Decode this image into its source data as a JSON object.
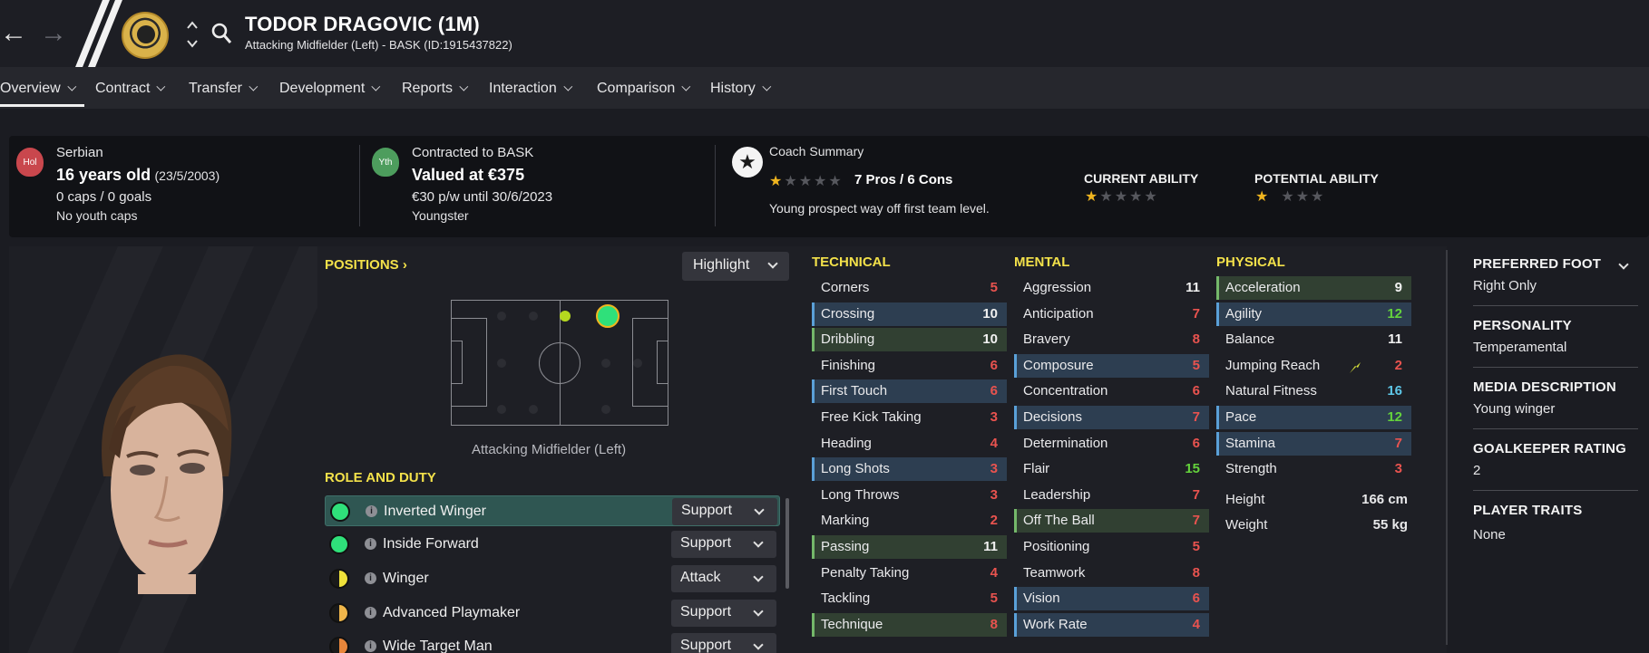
{
  "header": {
    "back_icon": "back-arrow-icon",
    "forward_icon": "forward-arrow-icon",
    "player_name": "TODOR DRAGOVIC (1M)",
    "subtitle": "Attacking Midfielder (Left) - BASK (ID:1915437822)"
  },
  "tabs": [
    {
      "label": "Overview"
    },
    {
      "label": "Contract"
    },
    {
      "label": "Transfer"
    },
    {
      "label": "Development"
    },
    {
      "label": "Reports"
    },
    {
      "label": "Interaction"
    },
    {
      "label": "Comparison"
    },
    {
      "label": "History"
    }
  ],
  "summary": {
    "nat_badge": "Hol",
    "nationality": "Serbian",
    "age": "16 years old",
    "dob": "(23/5/2003)",
    "caps": "0 caps / 0 goals",
    "youth_caps": "No youth caps",
    "contract_badge": "Yth",
    "contracted": "Contracted to BASK",
    "value": "Valued at €375",
    "wage": "€30 p/w until 30/6/2023",
    "status": "Youngster",
    "coach_title": "Coach Summary",
    "pros_cons": "7 Pros / 6 Cons",
    "coach_text": "Young prospect way off first team level.",
    "current_ability_label": "CURRENT ABILITY",
    "potential_ability_label": "POTENTIAL ABILITY",
    "coach_stars": 1,
    "current_ability_stars": 1,
    "potential_ability_stars": 1
  },
  "positions": {
    "title": "POSITIONS",
    "highlight": "Highlight",
    "position_label": "Attacking Midfielder (Left)"
  },
  "roles": {
    "title": "ROLE AND DUTY",
    "items": [
      {
        "name": "Inverted Winger",
        "duty": "Support",
        "color": "#2fe07a",
        "selected": true
      },
      {
        "name": "Inside Forward",
        "duty": "Support",
        "color": "#2fe07a"
      },
      {
        "name": "Winger",
        "duty": "Attack",
        "color": "#f0e23a"
      },
      {
        "name": "Advanced Playmaker",
        "duty": "Support",
        "color": "#f0b64a"
      },
      {
        "name": "Wide Target Man",
        "duty": "Support",
        "color": "#e8863a"
      }
    ]
  },
  "technical": {
    "title": "TECHNICAL",
    "items": [
      {
        "name": "Corners",
        "value": "5"
      },
      {
        "name": "Crossing",
        "value": "10"
      },
      {
        "name": "Dribbling",
        "value": "10"
      },
      {
        "name": "Finishing",
        "value": "6"
      },
      {
        "name": "First Touch",
        "value": "6"
      },
      {
        "name": "Free Kick Taking",
        "value": "3"
      },
      {
        "name": "Heading",
        "value": "4"
      },
      {
        "name": "Long Shots",
        "value": "3"
      },
      {
        "name": "Long Throws",
        "value": "3"
      },
      {
        "name": "Marking",
        "value": "2"
      },
      {
        "name": "Passing",
        "value": "11"
      },
      {
        "name": "Penalty Taking",
        "value": "4"
      },
      {
        "name": "Tackling",
        "value": "5"
      },
      {
        "name": "Technique",
        "value": "8"
      }
    ]
  },
  "mental": {
    "title": "MENTAL",
    "items": [
      {
        "name": "Aggression",
        "value": "11"
      },
      {
        "name": "Anticipation",
        "value": "7"
      },
      {
        "name": "Bravery",
        "value": "8"
      },
      {
        "name": "Composure",
        "value": "5"
      },
      {
        "name": "Concentration",
        "value": "6"
      },
      {
        "name": "Decisions",
        "value": "7"
      },
      {
        "name": "Determination",
        "value": "6"
      },
      {
        "name": "Flair",
        "value": "15"
      },
      {
        "name": "Leadership",
        "value": "7"
      },
      {
        "name": "Off The Ball",
        "value": "7"
      },
      {
        "name": "Positioning",
        "value": "5"
      },
      {
        "name": "Teamwork",
        "value": "8"
      },
      {
        "name": "Vision",
        "value": "6"
      },
      {
        "name": "Work Rate",
        "value": "4"
      }
    ]
  },
  "physical": {
    "title": "PHYSICAL",
    "items": [
      {
        "name": "Acceleration",
        "value": "9"
      },
      {
        "name": "Agility",
        "value": "12"
      },
      {
        "name": "Balance",
        "value": "11"
      },
      {
        "name": "Jumping Reach",
        "value": "2"
      },
      {
        "name": "Natural Fitness",
        "value": "16"
      },
      {
        "name": "Pace",
        "value": "12"
      },
      {
        "name": "Stamina",
        "value": "7"
      },
      {
        "name": "Strength",
        "value": "3"
      }
    ],
    "height_label": "Height",
    "height": "166 cm",
    "weight_label": "Weight",
    "weight": "55 kg"
  },
  "right_panel": {
    "foot_title": "PREFERRED FOOT",
    "foot": "Right Only",
    "personality_title": "PERSONALITY",
    "personality": "Temperamental",
    "media_title": "MEDIA DESCRIPTION",
    "media": "Young winger",
    "gk_title": "GOALKEEPER RATING",
    "gk": "2",
    "traits_title": "PLAYER TRAITS",
    "traits": "None"
  }
}
